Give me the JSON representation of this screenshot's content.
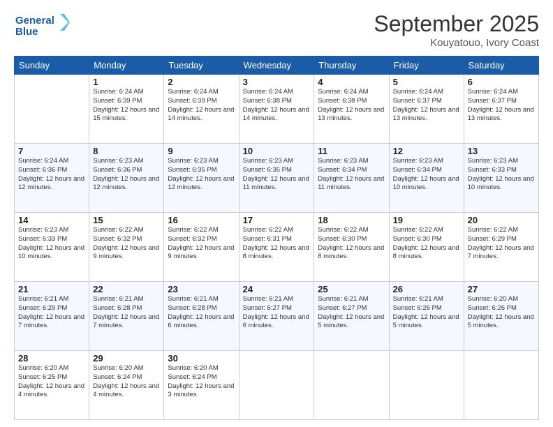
{
  "header": {
    "logo_line1": "General",
    "logo_line2": "Blue",
    "month": "September 2025",
    "location": "Kouyatouo, Ivory Coast"
  },
  "weekdays": [
    "Sunday",
    "Monday",
    "Tuesday",
    "Wednesday",
    "Thursday",
    "Friday",
    "Saturday"
  ],
  "weeks": [
    [
      {
        "num": "",
        "sunrise": "",
        "sunset": "",
        "daylight": ""
      },
      {
        "num": "1",
        "sunrise": "Sunrise: 6:24 AM",
        "sunset": "Sunset: 6:39 PM",
        "daylight": "Daylight: 12 hours and 15 minutes."
      },
      {
        "num": "2",
        "sunrise": "Sunrise: 6:24 AM",
        "sunset": "Sunset: 6:39 PM",
        "daylight": "Daylight: 12 hours and 14 minutes."
      },
      {
        "num": "3",
        "sunrise": "Sunrise: 6:24 AM",
        "sunset": "Sunset: 6:38 PM",
        "daylight": "Daylight: 12 hours and 14 minutes."
      },
      {
        "num": "4",
        "sunrise": "Sunrise: 6:24 AM",
        "sunset": "Sunset: 6:38 PM",
        "daylight": "Daylight: 12 hours and 13 minutes."
      },
      {
        "num": "5",
        "sunrise": "Sunrise: 6:24 AM",
        "sunset": "Sunset: 6:37 PM",
        "daylight": "Daylight: 12 hours and 13 minutes."
      },
      {
        "num": "6",
        "sunrise": "Sunrise: 6:24 AM",
        "sunset": "Sunset: 6:37 PM",
        "daylight": "Daylight: 12 hours and 13 minutes."
      }
    ],
    [
      {
        "num": "7",
        "sunrise": "Sunrise: 6:24 AM",
        "sunset": "Sunset: 6:36 PM",
        "daylight": "Daylight: 12 hours and 12 minutes."
      },
      {
        "num": "8",
        "sunrise": "Sunrise: 6:23 AM",
        "sunset": "Sunset: 6:36 PM",
        "daylight": "Daylight: 12 hours and 12 minutes."
      },
      {
        "num": "9",
        "sunrise": "Sunrise: 6:23 AM",
        "sunset": "Sunset: 6:35 PM",
        "daylight": "Daylight: 12 hours and 12 minutes."
      },
      {
        "num": "10",
        "sunrise": "Sunrise: 6:23 AM",
        "sunset": "Sunset: 6:35 PM",
        "daylight": "Daylight: 12 hours and 11 minutes."
      },
      {
        "num": "11",
        "sunrise": "Sunrise: 6:23 AM",
        "sunset": "Sunset: 6:34 PM",
        "daylight": "Daylight: 12 hours and 11 minutes."
      },
      {
        "num": "12",
        "sunrise": "Sunrise: 6:23 AM",
        "sunset": "Sunset: 6:34 PM",
        "daylight": "Daylight: 12 hours and 10 minutes."
      },
      {
        "num": "13",
        "sunrise": "Sunrise: 6:23 AM",
        "sunset": "Sunset: 6:33 PM",
        "daylight": "Daylight: 12 hours and 10 minutes."
      }
    ],
    [
      {
        "num": "14",
        "sunrise": "Sunrise: 6:23 AM",
        "sunset": "Sunset: 6:33 PM",
        "daylight": "Daylight: 12 hours and 10 minutes."
      },
      {
        "num": "15",
        "sunrise": "Sunrise: 6:22 AM",
        "sunset": "Sunset: 6:32 PM",
        "daylight": "Daylight: 12 hours and 9 minutes."
      },
      {
        "num": "16",
        "sunrise": "Sunrise: 6:22 AM",
        "sunset": "Sunset: 6:32 PM",
        "daylight": "Daylight: 12 hours and 9 minutes."
      },
      {
        "num": "17",
        "sunrise": "Sunrise: 6:22 AM",
        "sunset": "Sunset: 6:31 PM",
        "daylight": "Daylight: 12 hours and 8 minutes."
      },
      {
        "num": "18",
        "sunrise": "Sunrise: 6:22 AM",
        "sunset": "Sunset: 6:30 PM",
        "daylight": "Daylight: 12 hours and 8 minutes."
      },
      {
        "num": "19",
        "sunrise": "Sunrise: 6:22 AM",
        "sunset": "Sunset: 6:30 PM",
        "daylight": "Daylight: 12 hours and 8 minutes."
      },
      {
        "num": "20",
        "sunrise": "Sunrise: 6:22 AM",
        "sunset": "Sunset: 6:29 PM",
        "daylight": "Daylight: 12 hours and 7 minutes."
      }
    ],
    [
      {
        "num": "21",
        "sunrise": "Sunrise: 6:21 AM",
        "sunset": "Sunset: 6:29 PM",
        "daylight": "Daylight: 12 hours and 7 minutes."
      },
      {
        "num": "22",
        "sunrise": "Sunrise: 6:21 AM",
        "sunset": "Sunset: 6:28 PM",
        "daylight": "Daylight: 12 hours and 7 minutes."
      },
      {
        "num": "23",
        "sunrise": "Sunrise: 6:21 AM",
        "sunset": "Sunset: 6:28 PM",
        "daylight": "Daylight: 12 hours and 6 minutes."
      },
      {
        "num": "24",
        "sunrise": "Sunrise: 6:21 AM",
        "sunset": "Sunset: 6:27 PM",
        "daylight": "Daylight: 12 hours and 6 minutes."
      },
      {
        "num": "25",
        "sunrise": "Sunrise: 6:21 AM",
        "sunset": "Sunset: 6:27 PM",
        "daylight": "Daylight: 12 hours and 5 minutes."
      },
      {
        "num": "26",
        "sunrise": "Sunrise: 6:21 AM",
        "sunset": "Sunset: 6:26 PM",
        "daylight": "Daylight: 12 hours and 5 minutes."
      },
      {
        "num": "27",
        "sunrise": "Sunrise: 6:20 AM",
        "sunset": "Sunset: 6:26 PM",
        "daylight": "Daylight: 12 hours and 5 minutes."
      }
    ],
    [
      {
        "num": "28",
        "sunrise": "Sunrise: 6:20 AM",
        "sunset": "Sunset: 6:25 PM",
        "daylight": "Daylight: 12 hours and 4 minutes."
      },
      {
        "num": "29",
        "sunrise": "Sunrise: 6:20 AM",
        "sunset": "Sunset: 6:24 PM",
        "daylight": "Daylight: 12 hours and 4 minutes."
      },
      {
        "num": "30",
        "sunrise": "Sunrise: 6:20 AM",
        "sunset": "Sunset: 6:24 PM",
        "daylight": "Daylight: 12 hours and 3 minutes."
      },
      {
        "num": "",
        "sunrise": "",
        "sunset": "",
        "daylight": ""
      },
      {
        "num": "",
        "sunrise": "",
        "sunset": "",
        "daylight": ""
      },
      {
        "num": "",
        "sunrise": "",
        "sunset": "",
        "daylight": ""
      },
      {
        "num": "",
        "sunrise": "",
        "sunset": "",
        "daylight": ""
      }
    ]
  ]
}
